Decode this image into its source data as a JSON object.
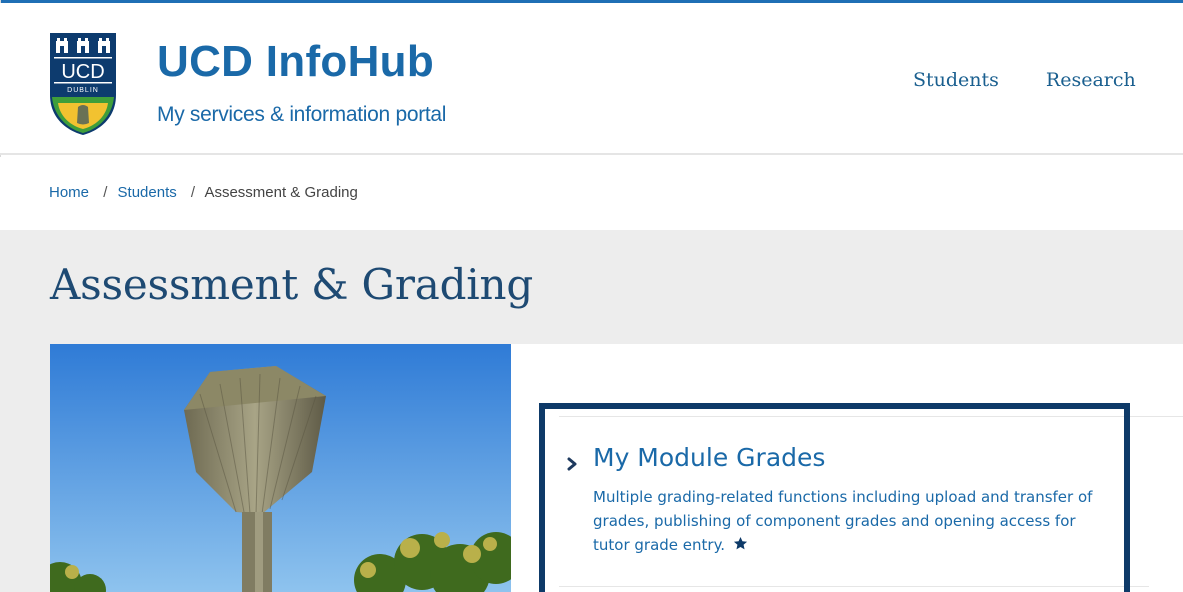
{
  "header": {
    "site_title": "UCD InfoHub",
    "site_subtitle": "My services & information portal",
    "crest_text": "UCD",
    "crest_subtext": "DUBLIN"
  },
  "nav": {
    "items": [
      {
        "label": "Students"
      },
      {
        "label": "Research"
      }
    ]
  },
  "breadcrumb": {
    "items": [
      {
        "label": "Home"
      },
      {
        "label": "Students"
      },
      {
        "label": "Assessment & Grading"
      }
    ],
    "separator": "/"
  },
  "page": {
    "title": "Assessment & Grading"
  },
  "content": {
    "items": [
      {
        "title": "My Module Grades",
        "description": "Multiple grading-related functions including upload and transfer of grades, publishing of component grades and opening access for tutor grade entry.",
        "icon": "star-icon"
      }
    ]
  },
  "colors": {
    "brand_blue": "#1a69a8",
    "navy": "#0e3a68",
    "band_gray": "#ededed"
  }
}
